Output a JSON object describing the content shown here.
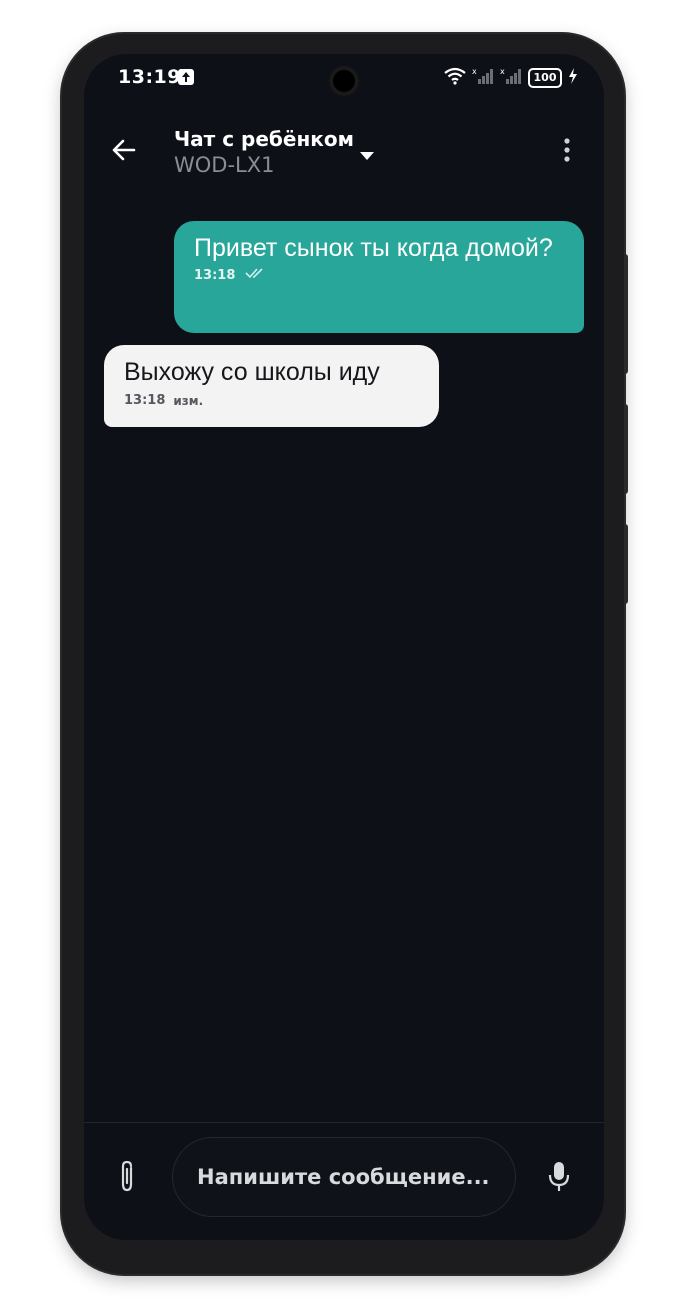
{
  "status_bar": {
    "time": "13:19",
    "battery": "100",
    "upload_icon": "upload-arrow-icon",
    "wifi_icon": "wifi-icon",
    "signal_icon": "signal-bars-icon",
    "charging_icon": "charging-bolt-icon"
  },
  "header": {
    "title": "Чат с ребёнком",
    "subtitle": "WOD-LX1",
    "back_icon": "arrow-left-icon",
    "dropdown_icon": "caret-down-icon",
    "menu_icon": "more-vertical-icon"
  },
  "messages": [
    {
      "direction": "outgoing",
      "text": "Привет сынок ты когда домой?",
      "time": "13:18",
      "status_icon": "double-check-icon"
    },
    {
      "direction": "incoming",
      "text": "Выхожу со школы иду",
      "time": "13:18",
      "edited_label": "изм."
    }
  ],
  "composer": {
    "placeholder": "Напишите сообщение...",
    "value": "",
    "attach_icon": "paperclip-icon",
    "mic_icon": "microphone-icon"
  },
  "colors": {
    "background": "#0d1117",
    "outgoing_bubble": "#27a699",
    "incoming_bubble": "#f3f3f4",
    "subtitle": "#8a8d93"
  }
}
